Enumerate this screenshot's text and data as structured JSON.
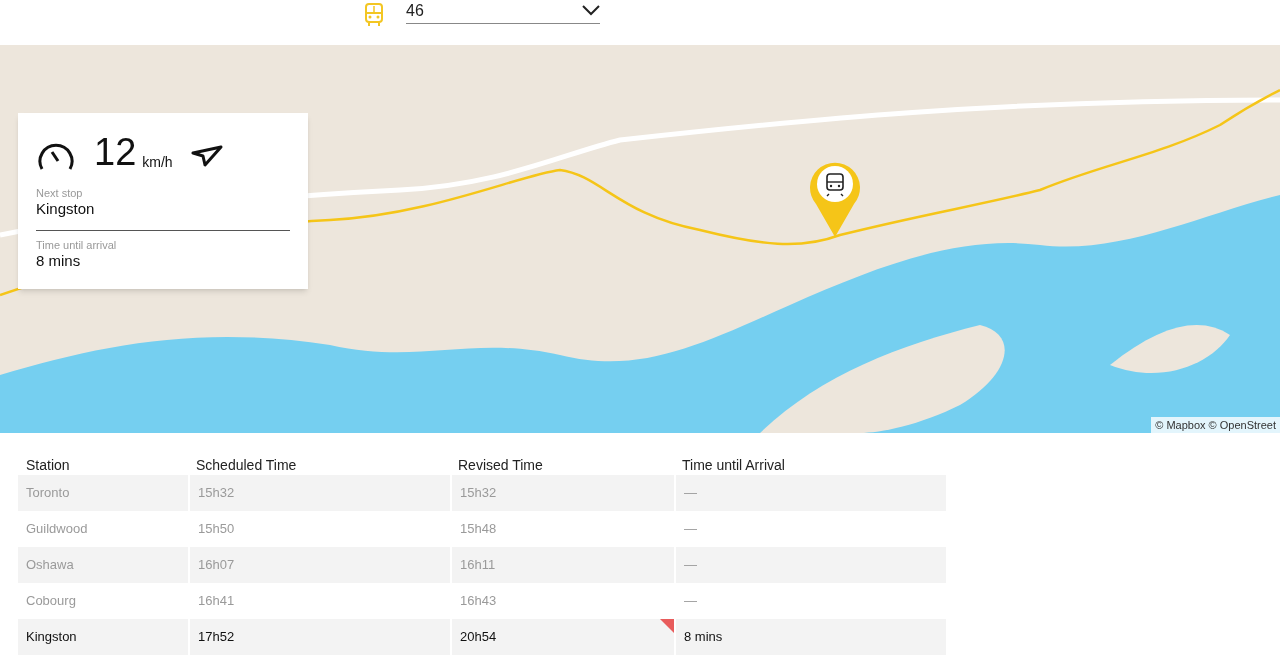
{
  "route_selector": {
    "value": "46"
  },
  "speed_card": {
    "speed": "12",
    "unit": "km/h",
    "next_stop_label": "Next stop",
    "next_stop": "Kingston",
    "arrival_label": "Time until arrival",
    "arrival": "8 mins"
  },
  "map": {
    "attribution": "© Mapbox © OpenStreet"
  },
  "table": {
    "columns": [
      "Station",
      "Scheduled Time",
      "Revised Time",
      "Time until Arrival"
    ],
    "rows": [
      {
        "passed": true,
        "delayed": false,
        "cells": [
          "Toronto",
          "15h32",
          "15h32",
          "—"
        ]
      },
      {
        "passed": true,
        "delayed": false,
        "cells": [
          "Guildwood",
          "15h50",
          "15h48",
          "—"
        ]
      },
      {
        "passed": true,
        "delayed": false,
        "cells": [
          "Oshawa",
          "16h07",
          "16h11",
          "—"
        ]
      },
      {
        "passed": true,
        "delayed": false,
        "cells": [
          "Cobourg",
          "16h41",
          "16h43",
          "—"
        ]
      },
      {
        "passed": false,
        "delayed": true,
        "cells": [
          "Kingston",
          "17h52",
          "20h54",
          "8 mins"
        ]
      }
    ]
  }
}
